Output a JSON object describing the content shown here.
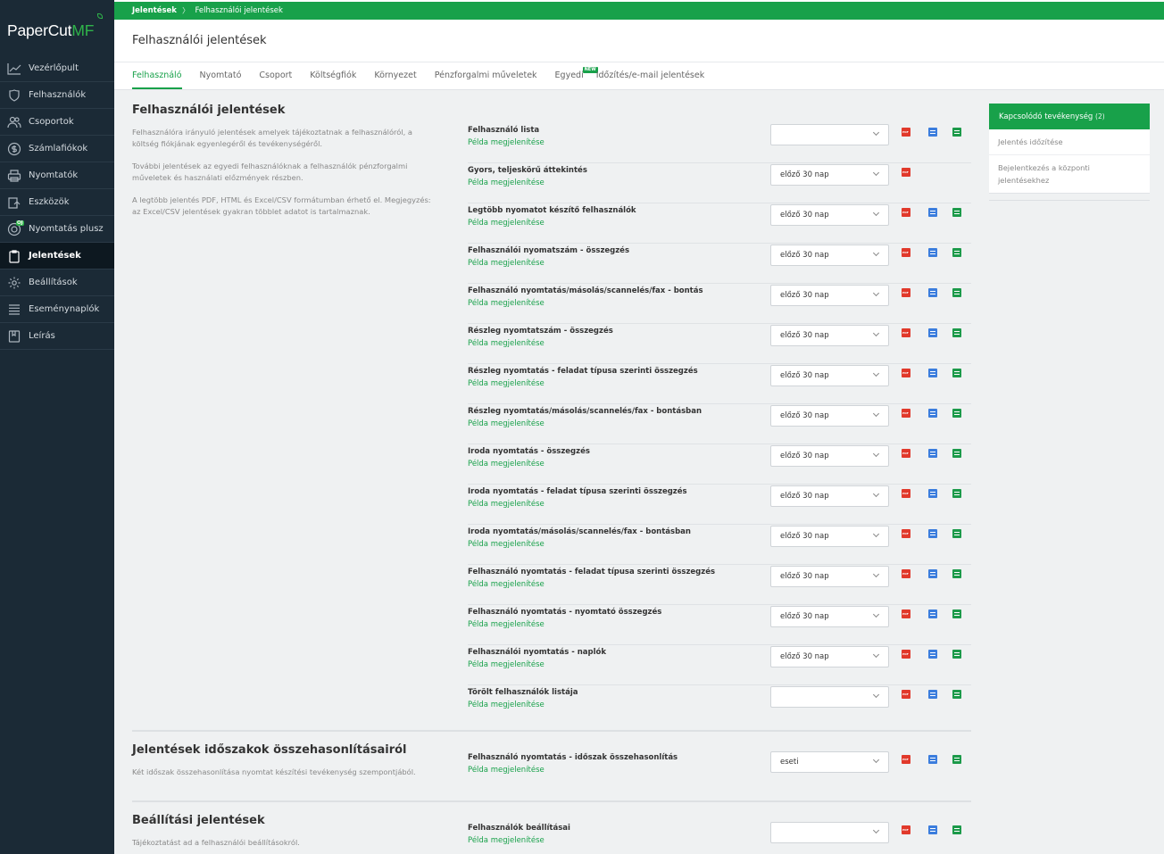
{
  "app": {
    "logo_main": "PaperCut",
    "logo_accent": "MF"
  },
  "breadcrumb": {
    "root": "Jelentések",
    "current": "Felhasználói jelentések"
  },
  "page_title": "Felhasználói jelentések",
  "sidebar": {
    "items": [
      {
        "label": "Vezérlőpult",
        "icon": "chart-line-icon"
      },
      {
        "label": "Felhasználók",
        "icon": "user-shield-icon"
      },
      {
        "label": "Csoportok",
        "icon": "users-icon"
      },
      {
        "label": "Számlafiókok",
        "icon": "dollar-circle-icon"
      },
      {
        "label": "Nyomtatók",
        "icon": "printer-icon"
      },
      {
        "label": "Eszközök",
        "icon": "device-icon"
      },
      {
        "label": "Nyomtatás plusz",
        "icon": "print-plus-icon",
        "badge": "OJ"
      },
      {
        "label": "Jelentések",
        "icon": "clipboard-icon",
        "active": true
      },
      {
        "label": "Beállítások",
        "icon": "gear-icon"
      },
      {
        "label": "Eseménynaplók",
        "icon": "list-icon"
      },
      {
        "label": "Leírás",
        "icon": "book-icon"
      }
    ]
  },
  "tabs": [
    {
      "label": "Felhasználó",
      "active": true
    },
    {
      "label": "Nyomtató"
    },
    {
      "label": "Csoport"
    },
    {
      "label": "Költségfiók"
    },
    {
      "label": "Környezet"
    },
    {
      "label": "Pénzforgalmi műveletek"
    },
    {
      "label": "Egyedi",
      "badge": "NEW"
    },
    {
      "label": "Időzítés/e-mail jelentések"
    }
  ],
  "sections": {
    "user_reports": {
      "title": "Felhasználói jelentések",
      "desc": [
        "Felhasználóra irányuló jelentések amelyek tájékoztatnak a felhasználóról, a költség fiókjának egyenlegéről és tevékenységéről.",
        "További jelentések az egyedi felhasználóknak a felhasználók pénzforgalmi műveletek és használati előzmények részben.",
        "A legtöbb jelentés PDF, HTML és Excel/CSV formátumban érhető el. Megjegyzés: az Excel/CSV jelentések gyakran többlet adatot is tartalmaznak."
      ]
    },
    "period_compare": {
      "title": "Jelentések időszakok összehasonlításairól",
      "desc": "Két időszak összehasonlítása nyomtat készítési tevékenység szempontjából."
    },
    "settings_reports": {
      "title": "Beállítási jelentések",
      "desc": "Tájékoztatást ad a felhasználói beállításokról."
    }
  },
  "example_link": "Példa megjelenítése",
  "reports": [
    {
      "name": "Felhasználó lista",
      "period": "",
      "html": true,
      "csv": true
    },
    {
      "name": "Gyors, teljeskörű áttekintés",
      "period": "előző 30 nap",
      "html": false,
      "csv": false
    },
    {
      "name": "Legtöbb nyomatot készítő felhasználók",
      "period": "előző 30 nap",
      "html": true,
      "csv": true
    },
    {
      "name": "Felhasználói nyomatszám - összegzés",
      "period": "előző 30 nap",
      "html": true,
      "csv": true
    },
    {
      "name": "Felhasználó nyomtatás/másolás/scannelés/fax - bontás",
      "period": "előző 30 nap",
      "html": true,
      "csv": true
    },
    {
      "name": "Részleg nyomtatszám - összegzés",
      "period": "előző 30 nap",
      "html": true,
      "csv": true
    },
    {
      "name": "Részleg nyomtatás - feladat típusa szerinti összegzés",
      "period": "előző 30 nap",
      "html": true,
      "csv": true
    },
    {
      "name": "Részleg nyomtatás/másolás/scannelés/fax - bontásban",
      "period": "előző 30 nap",
      "html": true,
      "csv": true
    },
    {
      "name": "Iroda nyomtatás - összegzés",
      "period": "előző 30 nap",
      "html": true,
      "csv": true
    },
    {
      "name": "Iroda nyomtatás - feladat típusa szerinti összegzés",
      "period": "előző 30 nap",
      "html": true,
      "csv": true
    },
    {
      "name": "Iroda nyomtatás/másolás/scannelés/fax - bontásban",
      "period": "előző 30 nap",
      "html": true,
      "csv": true
    },
    {
      "name": "Felhasználó nyomtatás - feladat típusa szerinti összegzés",
      "period": "előző 30 nap",
      "html": true,
      "csv": true
    },
    {
      "name": "Felhasználó nyomtatás - nyomtató összegzés",
      "period": "előző 30 nap",
      "html": true,
      "csv": true
    },
    {
      "name": "Felhasználói nyomtatás - naplók",
      "period": "előző 30 nap",
      "html": true,
      "csv": true
    },
    {
      "name": "Törölt felhasználók listája",
      "period": "",
      "html": true,
      "csv": true
    }
  ],
  "compare_report": {
    "name": "Felhasználó nyomtatás - időszak összehasonlítás",
    "period": "eseti"
  },
  "settings_report": {
    "name": "Felhasználók beállításai",
    "period": ""
  },
  "right_panel": {
    "title": "Kapcsolódó tevékenység",
    "count": "(2)",
    "items": [
      "Jelentés időzítése",
      "Bejelentkezés a központi jelentésekhez"
    ]
  },
  "colors": {
    "brand_green": "#18a14a",
    "sidebar_bg": "#1b2a36",
    "pdf_red": "#e1392b",
    "html_blue": "#3b7ddd",
    "csv_green": "#1c9a4a"
  }
}
